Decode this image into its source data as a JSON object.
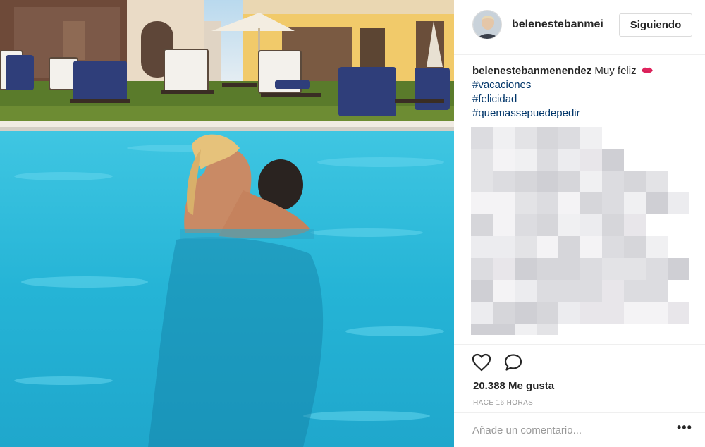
{
  "post": {
    "author": {
      "username": "belenestebanmenendez",
      "username_display": "belenestebanmei"
    },
    "follow_button_label": "Siguiendo",
    "caption": {
      "text": "Muy feliz",
      "emoji": "kiss-lips-icon",
      "hashtags": [
        "#vacaciones",
        "#felicidad",
        "#quemassepuedepedir"
      ]
    },
    "likes_text": "20.388 Me gusta",
    "timestamp": "HACE 16 HORAS",
    "comment_placeholder": "Añade un comentario...",
    "more_label": "•••"
  },
  "colors": {
    "hashtag": "#003569",
    "pool_water": "#29b8d6",
    "border": "#efefef",
    "muted_text": "#999999"
  }
}
